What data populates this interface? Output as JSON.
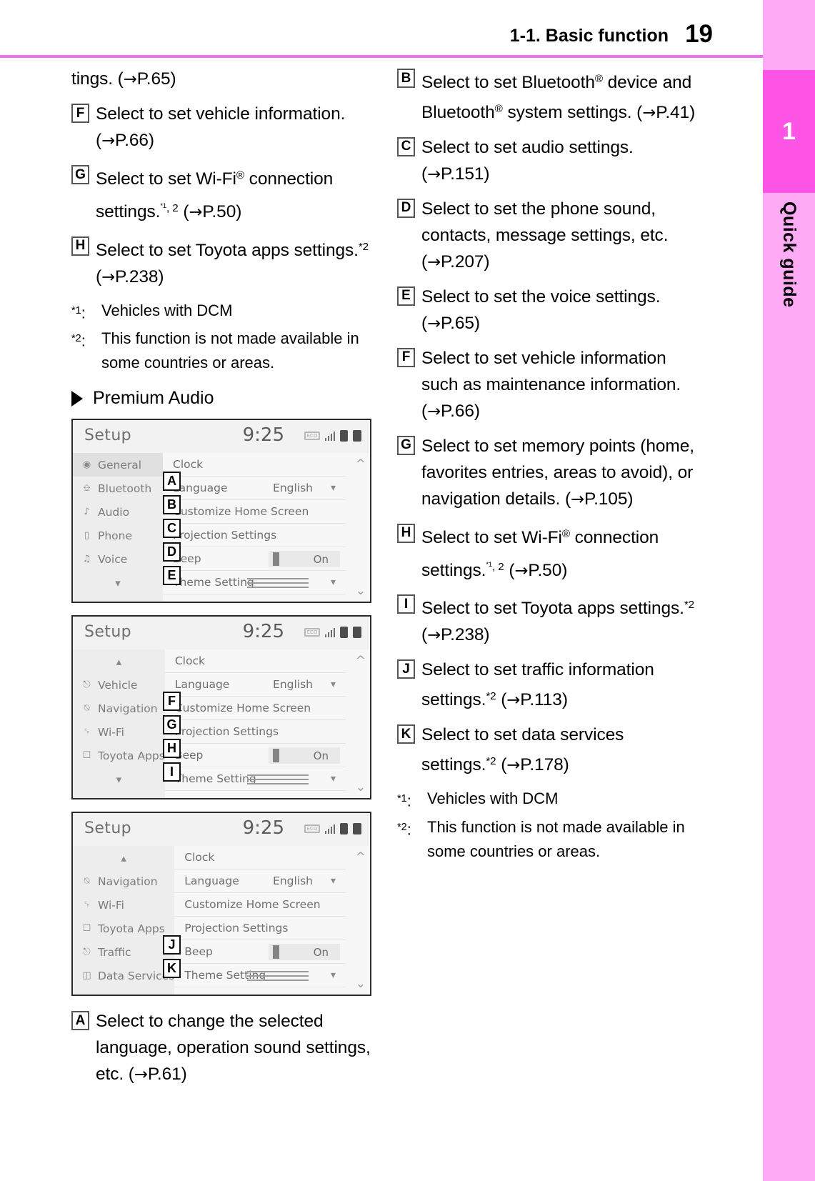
{
  "header": {
    "section_title": "1-1. Basic function",
    "page_number": "19"
  },
  "edge_tab": {
    "chapter_number": "1",
    "chapter_label": "Quick guide",
    "band_color": "#ffaaf5",
    "chip_color": "#ff55e6",
    "rule_color": "#f06cf0"
  },
  "left_column": {
    "continuation": {
      "text_before": "tings. (",
      "arrow": "→",
      "text_after": "P.65)"
    },
    "callouts": [
      {
        "badge": "F",
        "segments": [
          {
            "t": "Select to set vehicle informa-"
          },
          {
            "t": "tion. ("
          },
          {
            "arrow": true
          },
          {
            "t": "P.66)"
          }
        ],
        "plain": "Select to set vehicle information. (→P.66)"
      },
      {
        "badge": "G",
        "plain": "Select to set Wi-Fi® connection settings.*1, 2 (→P.50)"
      },
      {
        "badge": "H",
        "plain": "Select to set Toyota apps settings.*2 (→P.238)"
      }
    ],
    "footnotes": [
      {
        "mark": "*1",
        "text": "Vehicles with DCM"
      },
      {
        "mark": "*2",
        "text": "This function is not made available in some countries or areas."
      }
    ],
    "subheading": "Premium Audio",
    "bottom_callout": {
      "badge": "A",
      "plain": "Select to change the selected language, operation sound settings, etc. (→P.61)"
    }
  },
  "right_column": {
    "callouts": [
      {
        "badge": "B",
        "plain": "Select to set Bluetooth® device and Bluetooth® system settings. (→P.41)"
      },
      {
        "badge": "C",
        "plain": "Select to set audio settings. (→P.151)"
      },
      {
        "badge": "D",
        "plain": "Select to set the phone sound, contacts, message settings, etc. (→P.207)"
      },
      {
        "badge": "E",
        "plain": "Select to set the voice settings. (→P.65)"
      },
      {
        "badge": "F",
        "plain": "Select to set vehicle information such as maintenance information. (→P.66)"
      },
      {
        "badge": "G",
        "plain": "Select to set memory points (home, favorites entries, areas to avoid), or navigation details. (→P.105)"
      },
      {
        "badge": "H",
        "plain": "Select to set Wi-Fi® connection settings.*1, 2 (→P.50)"
      },
      {
        "badge": "I",
        "plain": "Select to set Toyota apps settings.*2 (→P.238)"
      },
      {
        "badge": "J",
        "plain": "Select to set traffic information settings.*2 (→P.113)"
      },
      {
        "badge": "K",
        "plain": "Select to set data services settings.*2 (→P.178)"
      }
    ],
    "footnotes": [
      {
        "mark": "*1",
        "text": "Vehicles with DCM"
      },
      {
        "mark": "*2",
        "text": "This function is not made available in some countries or areas."
      }
    ]
  },
  "screenshots": [
    {
      "id": "setup-screen-1",
      "title": "Setup",
      "clock": "9:25",
      "status_icons": [
        "eco-icon",
        "signal-bars-icon",
        "phone-icon",
        "battery-icon"
      ],
      "sidebar": [
        {
          "icon": "gear-icon",
          "label": "General",
          "selected": true
        },
        {
          "icon": "bluetooth-icon",
          "label": "Bluetooth",
          "selected": false
        },
        {
          "icon": "music-note-icon",
          "label": "Audio",
          "selected": false
        },
        {
          "icon": "phone-icon",
          "label": "Phone",
          "selected": false
        },
        {
          "icon": "voice-icon",
          "label": "Voice",
          "selected": false
        }
      ],
      "sidebar_scroll_down": "∨",
      "rows": [
        {
          "label": "Clock",
          "value": "",
          "control": "none",
          "overlay": "A"
        },
        {
          "label": "Language",
          "value": "English",
          "control": "chevron",
          "overlay": "B"
        },
        {
          "label": "Customize Home Screen",
          "value": "",
          "control": "none",
          "overlay": "C"
        },
        {
          "label": "Projection Settings",
          "value": "",
          "control": "none",
          "overlay": "D"
        },
        {
          "label": "Beep",
          "value": "On",
          "control": "toggle",
          "overlay": "E"
        },
        {
          "label": "Theme Setting",
          "value": "",
          "control": "lines-chevron",
          "overlay": ""
        }
      ]
    },
    {
      "id": "setup-screen-2",
      "title": "Setup",
      "clock": "9:25",
      "status_icons": [
        "eco-icon",
        "signal-bars-icon",
        "phone-icon",
        "battery-icon"
      ],
      "sidebar_scroll_up": "∧",
      "sidebar": [
        {
          "icon": "car-icon",
          "label": "Vehicle",
          "selected": false
        },
        {
          "icon": "navigation-icon",
          "label": "Navigation",
          "selected": false
        },
        {
          "icon": "wifi-icon",
          "label": "Wi-Fi",
          "selected": false
        },
        {
          "icon": "toyota-apps-icon",
          "label": "Toyota Apps",
          "selected": false
        }
      ],
      "sidebar_scroll_down": "∨",
      "rows": [
        {
          "label": "Clock",
          "value": "",
          "control": "none",
          "overlay": ""
        },
        {
          "label": "Language",
          "value": "English",
          "control": "chevron",
          "overlay": "F"
        },
        {
          "label": "Customize Home Screen",
          "value": "",
          "control": "none",
          "overlay": "G"
        },
        {
          "label": "Projection Settings",
          "value": "",
          "control": "none",
          "overlay": "H"
        },
        {
          "label": "Beep",
          "value": "On",
          "control": "toggle",
          "overlay": "I"
        },
        {
          "label": "Theme Setting",
          "value": "",
          "control": "lines-chevron",
          "overlay": ""
        }
      ]
    },
    {
      "id": "setup-screen-3",
      "title": "Setup",
      "clock": "9:25",
      "status_icons": [
        "eco-icon",
        "signal-bars-icon",
        "phone-icon",
        "battery-icon"
      ],
      "sidebar_scroll_up": "∧",
      "sidebar": [
        {
          "icon": "navigation-icon",
          "label": "Navigation",
          "selected": false
        },
        {
          "icon": "wifi-icon",
          "label": "Wi-Fi",
          "selected": false
        },
        {
          "icon": "toyota-apps-icon",
          "label": "Toyota Apps",
          "selected": false
        },
        {
          "icon": "traffic-icon",
          "label": "Traffic",
          "selected": false
        },
        {
          "icon": "data-services-icon",
          "label": "Data Services",
          "selected": false
        }
      ],
      "rows": [
        {
          "label": "Clock",
          "value": "",
          "control": "none",
          "overlay": ""
        },
        {
          "label": "Language",
          "value": "English",
          "control": "chevron",
          "overlay": ""
        },
        {
          "label": "Customize Home Screen",
          "value": "",
          "control": "none",
          "overlay": ""
        },
        {
          "label": "Projection Settings",
          "value": "",
          "control": "none",
          "overlay": ""
        },
        {
          "label": "Beep",
          "value": "On",
          "control": "toggle",
          "overlay": "J"
        },
        {
          "label": "Theme Setting",
          "value": "",
          "control": "lines-chevron",
          "overlay": "K"
        }
      ]
    }
  ]
}
